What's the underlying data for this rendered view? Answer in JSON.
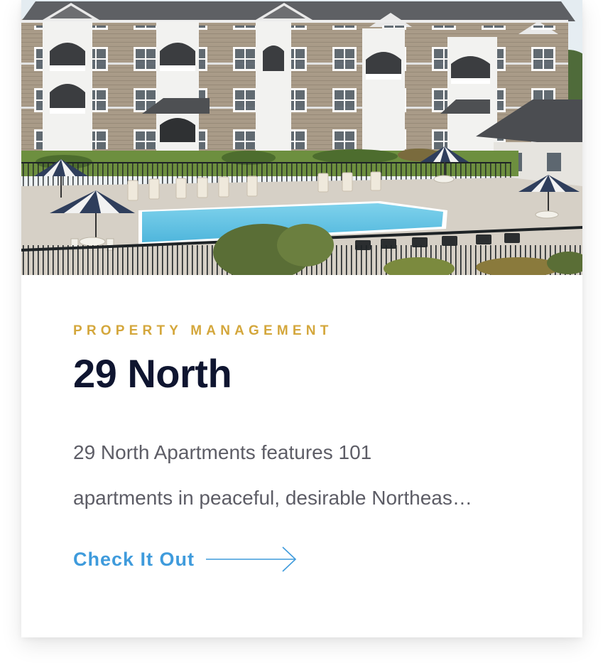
{
  "card": {
    "category": "PROPERTY MANAGEMENT",
    "title": "29 North",
    "description_line1": "29 North Apartments features 101",
    "description_line2": "apartments in peaceful, desirable Northeas…",
    "cta_label": "Check It Out",
    "cta_icon": "arrow-right-icon",
    "image_subject": "apartment-complex-with-pool"
  },
  "colors": {
    "category": "#d4a73c",
    "title": "#0f1530",
    "description": "#5d5d66",
    "accent": "#3f9bdc"
  }
}
